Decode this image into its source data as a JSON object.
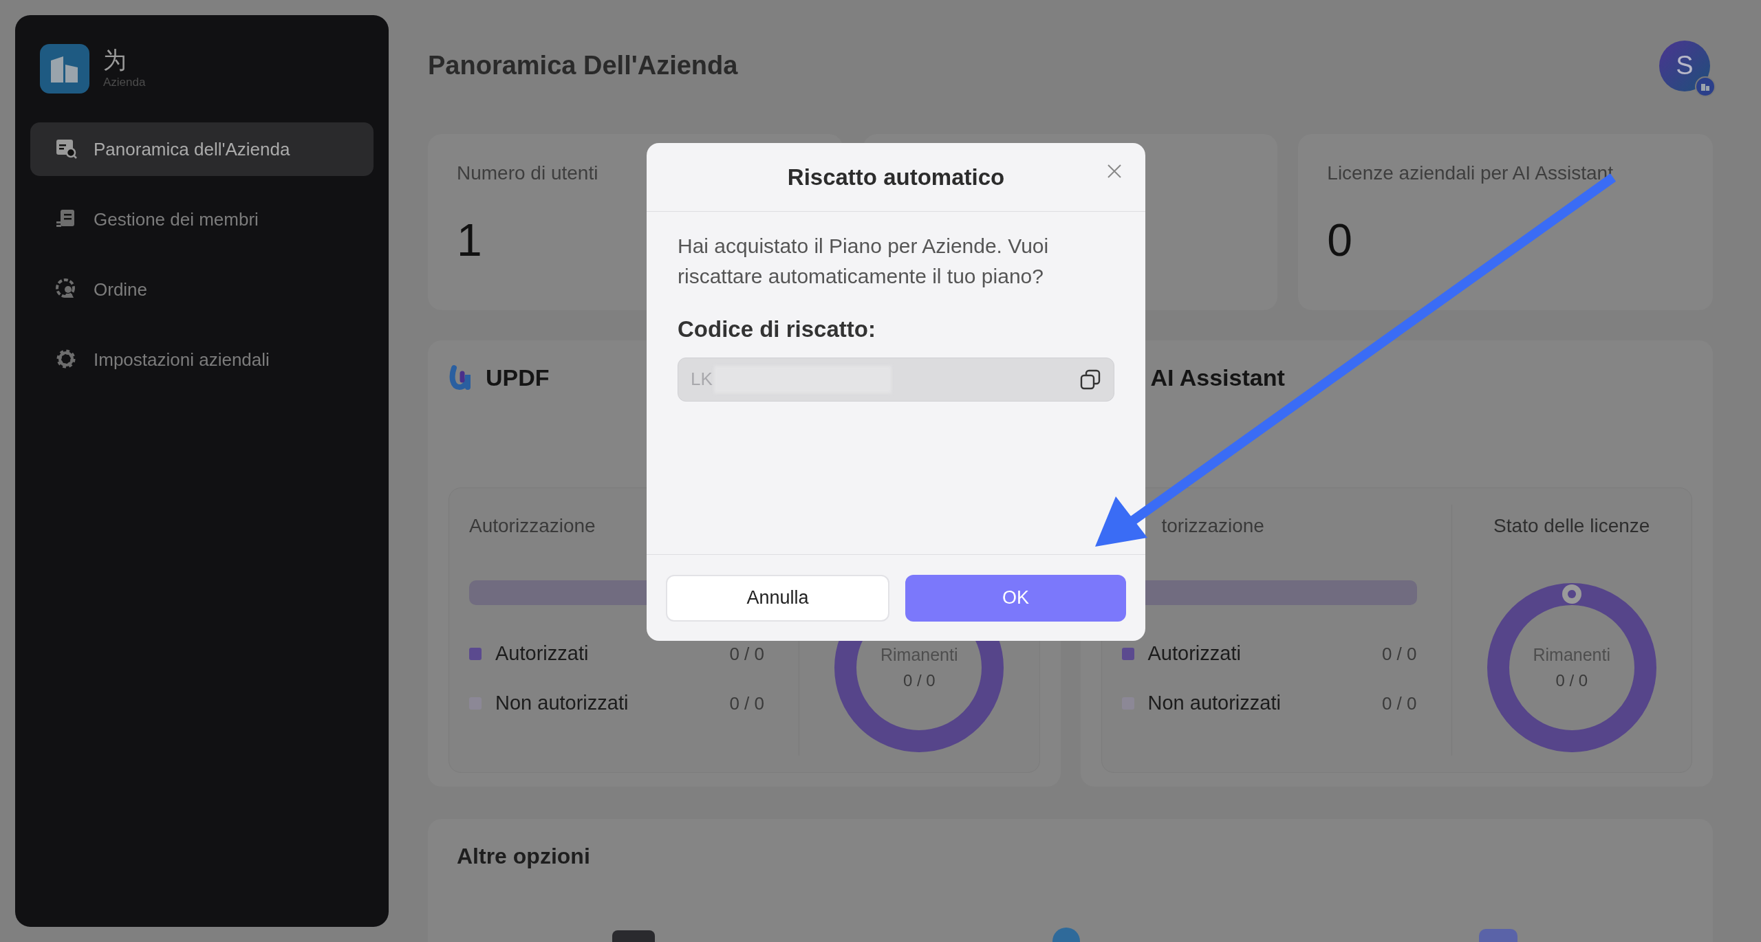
{
  "sidebar": {
    "brand": {
      "glyph": "为",
      "subtitle": "Azienda"
    },
    "items": [
      {
        "label": "Panoramica dell'Azienda",
        "kind": "overview",
        "selected": true
      },
      {
        "label": "Gestione dei membri",
        "kind": "members",
        "selected": false
      },
      {
        "label": "Ordine",
        "kind": "order",
        "selected": false
      },
      {
        "label": "Impostazioni aziendali",
        "kind": "settings",
        "selected": false
      }
    ]
  },
  "header": {
    "title": "Panoramica Dell'Azienda",
    "avatar": "S"
  },
  "stats": [
    {
      "label": "Numero di utenti",
      "value": "1"
    },
    {
      "label": "Licenze aziendali per AI Assistant",
      "value": "0"
    }
  ],
  "products": [
    {
      "kind": "updf",
      "title": "UPDF",
      "auth_label": "Autorizzazione",
      "legend": [
        {
          "label": "Autorizzati",
          "value": "0 / 0",
          "color": "#5b4a8f"
        },
        {
          "label": "Non autorizzati",
          "value": "0 / 0",
          "color": "#8c8896"
        }
      ],
      "donut": {
        "label": "Rimanenti",
        "value": "0 / 0"
      }
    },
    {
      "kind": "ai",
      "title": "AI Assistant",
      "auth_label": "torizzazione",
      "status_title": "Stato delle licenze",
      "legend": [
        {
          "label": "Autorizzati",
          "value": "0 / 0",
          "color": "#5b4a8f"
        },
        {
          "label": "Non autorizzati",
          "value": "0 / 0",
          "color": "#8c8896"
        }
      ],
      "donut": {
        "label": "Rimanenti",
        "value": "0 / 0"
      }
    }
  ],
  "other_options": {
    "title": "Altre opzioni"
  },
  "dialog": {
    "title": "Riscatto automatico",
    "message": "Hai acquistato il Piano per Aziende. Vuoi riscattare automaticamente il tuo piano?",
    "code_label": "Codice di riscatto:",
    "code_value": "LK",
    "buttons": [
      {
        "label": "Annulla",
        "kind": "secondary"
      },
      {
        "label": "OK",
        "kind": "primary"
      }
    ]
  }
}
